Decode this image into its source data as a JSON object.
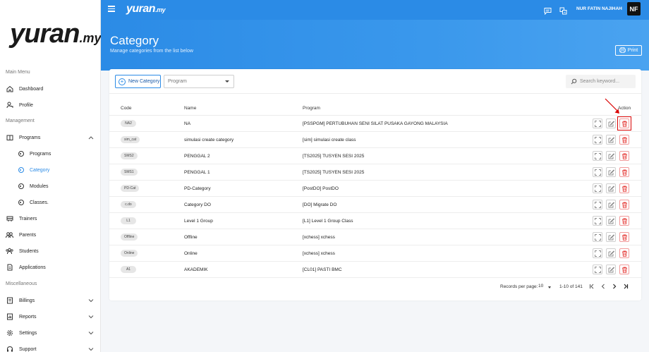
{
  "app": {
    "name": "yuran",
    "domain": ".my"
  },
  "header": {
    "user_name": "NUR FATIN NAJIHAH",
    "avatar_initials": "NF"
  },
  "sidebar": {
    "sections": {
      "main": "Main Menu",
      "management": "Management",
      "misc": "Miscellaneous"
    },
    "items": {
      "dashboard": "Dashboard",
      "profile": "Profile",
      "programs": "Programs",
      "programs_sub": "Programs",
      "category": "Category",
      "modules": "Modules",
      "classes": "Classes.",
      "trainers": "Trainers",
      "parents": "Parents",
      "students": "Students",
      "applications": "Applications",
      "billings": "Billings",
      "reports": "Reports",
      "settings": "Settings",
      "support": "Support"
    }
  },
  "page": {
    "title": "Category",
    "subtitle": "Manage categories from the list below",
    "print_label": "Print"
  },
  "toolbar": {
    "new_category_label": "New Category",
    "program_placeholder": "Program",
    "search_placeholder": "Search keyword..."
  },
  "table": {
    "headers": {
      "code": "Code",
      "name": "Name",
      "program": "Program",
      "action": "Action"
    },
    "rows": [
      {
        "code": "NA2",
        "name": "NA",
        "program": "[PSSPGM] PERTUBUHAN SENI SILAT PUSAKA GAYONG MALAYSIA"
      },
      {
        "code": "sim_cat",
        "name": "simulasi create category",
        "program": "[sim] simulasi create class"
      },
      {
        "code": "SMS2",
        "name": "PENGGAL 2",
        "program": "[TS2025] TUSYEN SESI 2025"
      },
      {
        "code": "SMS1",
        "name": "PENGGAL 1",
        "program": "[TS2025] TUSYEN SESI 2025"
      },
      {
        "code": "PD-Cat",
        "name": "PD-Category",
        "program": "[PostDO] PostDO"
      },
      {
        "code": "c.do",
        "name": "Category DO",
        "program": "[DO] Migrate DO"
      },
      {
        "code": "L1",
        "name": "Level 1 Group",
        "program": "[L1] Level 1 Group Class"
      },
      {
        "code": "Offline",
        "name": "Offline",
        "program": "[xchess] xchess"
      },
      {
        "code": "Online",
        "name": "Online",
        "program": "[xchess] xchess"
      },
      {
        "code": "A1",
        "name": "AKADEMIK",
        "program": "[CL01] PASTI BMC"
      }
    ]
  },
  "pagination": {
    "records_label": "Records per page:",
    "page_size": "10",
    "range": "1-10 of 141"
  },
  "colors": {
    "primary": "#2b8be6",
    "danger": "#e53935",
    "highlight": "#d90000"
  }
}
